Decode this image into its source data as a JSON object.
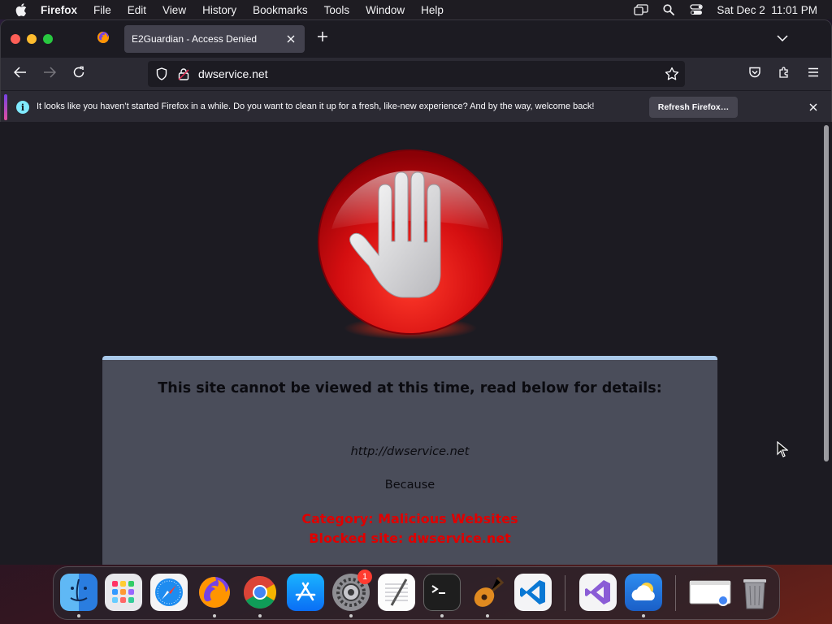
{
  "menubar": {
    "apple_icon": "apple-logo-icon",
    "app_name": "Firefox",
    "items": [
      "File",
      "Edit",
      "View",
      "History",
      "Bookmarks",
      "Tools",
      "Window",
      "Help"
    ],
    "status_icons": [
      "screen-mirroring-icon",
      "spotlight-search-icon",
      "control-center-icon"
    ],
    "clock": "Sat Dec 2  11:01 PM"
  },
  "browser": {
    "tab_title": "E2Guardian - Access Denied",
    "url": "dwservice.net",
    "notification": {
      "message": "It looks like you haven’t started Firefox in a while. Do you want to clean it up for a fresh, like-new experience? And by the way, welcome back!",
      "button_label": "Refresh Firefox…",
      "icon": "info-icon"
    }
  },
  "page": {
    "heading": "This site cannot be viewed at this time, read below for details:",
    "blocked_url": "http://dwservice.net",
    "because": "Because",
    "category": "Category: Malicious Websites",
    "blocked_site": "Blocked site: dwservice.net",
    "icon": "stop-hand-icon"
  },
  "dock": {
    "apps": [
      "Finder",
      "Launchpad",
      "Safari",
      "Firefox",
      "Chrome",
      "App Store",
      "System Settings",
      "TextEdit",
      "Terminal",
      "GarageBand",
      "Visual Studio Code",
      "Visual Studio",
      "Weather",
      "Chrome window",
      "Trash"
    ],
    "settings_badge": "1"
  },
  "colors": {
    "blocked_text": "#e00000",
    "panel_bg": "#4a4d5a",
    "panel_border": "#a9c9ea",
    "page_bg": "#1c1b22"
  }
}
